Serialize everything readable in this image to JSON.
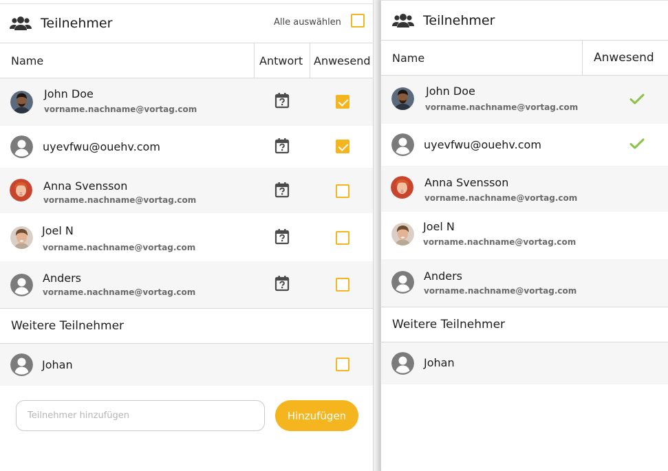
{
  "left": {
    "title": "Teilnehmer",
    "icon": "people-icon",
    "select_all_label": "Alle auswählen",
    "columns": {
      "name": "Name",
      "answer": "Antwort",
      "present": "Anwesend"
    },
    "participants": [
      {
        "name": "John Doe",
        "email": "vorname.nachname@vortag.com",
        "avatar": "photo",
        "present": true
      },
      {
        "name": "uyevfwu@ouehv.com",
        "email": "",
        "avatar": "generic",
        "present": true
      },
      {
        "name": "Anna Svensson",
        "email": "vorname.nachname@vortag.com",
        "avatar": "photo",
        "present": false
      },
      {
        "name": "Joel N",
        "email": "vorname.nachname@vortag.com",
        "avatar": "photo",
        "present": false
      },
      {
        "name": "Anders",
        "email": "vorname.nachname@vortag.com",
        "avatar": "generic",
        "present": false
      }
    ],
    "more_section": "Weitere Teilnehmer",
    "more": [
      {
        "name": "Johan",
        "avatar": "generic",
        "present": false
      }
    ],
    "add_placeholder": "Teilnehmer hinzufügen",
    "add_button": "Hinzufügen"
  },
  "right": {
    "title": "Teilnehmer",
    "columns": {
      "name": "Name",
      "present": "Anwesend"
    },
    "participants": [
      {
        "name": "John Doe",
        "email": "vorname.nachname@vortag.com",
        "present": true
      },
      {
        "name": "uyevfwu@ouehv.com",
        "email": "",
        "present": true
      },
      {
        "name": "Anna Svensson",
        "email": "vorname.nachname@vortag.com",
        "present": false
      },
      {
        "name": "Joel N",
        "email": "vorname.nachname@vortag.com",
        "present": false
      },
      {
        "name": "Anders",
        "email": "vorname.nachname@vortag.com",
        "present": false
      }
    ],
    "more_section": "Weitere Teilnehmer",
    "more": [
      {
        "name": "Johan"
      }
    ]
  },
  "colors": {
    "accent": "#f4b51e",
    "check_green": "#8bc34a",
    "row_shade": "#f6f6f6"
  }
}
